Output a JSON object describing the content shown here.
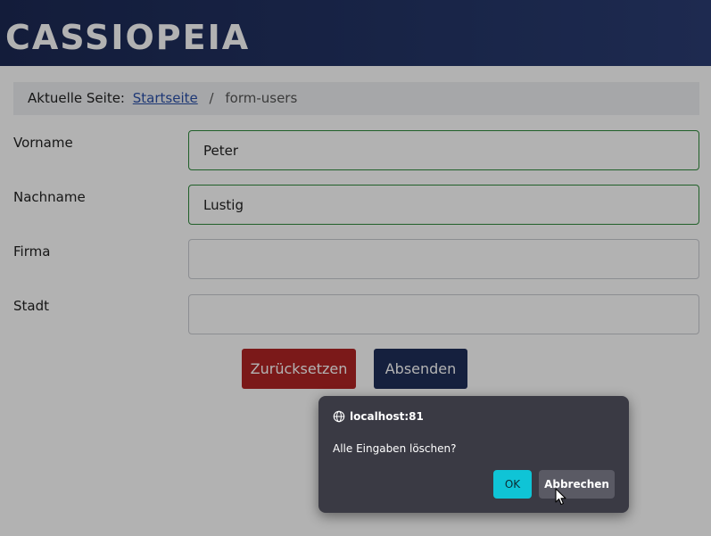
{
  "header": {
    "brand": "CASSIOPEIA"
  },
  "breadcrumb": {
    "prefix": "Aktuelle Seite:",
    "home_link": "Startseite",
    "separator": "/",
    "current": "form-users"
  },
  "form": {
    "fields": [
      {
        "label": "Vorname",
        "value": "Peter"
      },
      {
        "label": "Nachname",
        "value": "Lustig"
      },
      {
        "label": "Firma",
        "value": ""
      },
      {
        "label": "Stadt",
        "value": ""
      }
    ],
    "reset_label": "Zurücksetzen",
    "submit_label": "Absenden"
  },
  "dialog": {
    "origin": "localhost:81",
    "message": "Alle Eingaben löschen?",
    "ok_label": "OK",
    "cancel_label": "Abbrechen"
  },
  "colors": {
    "header_bg": "#1c2954",
    "reset_button": "#b12525",
    "submit_button": "#1f2e5a",
    "valid_border": "#2e8a3c",
    "dialog_bg": "#3a3a44",
    "dialog_ok": "#0fc4d6"
  }
}
